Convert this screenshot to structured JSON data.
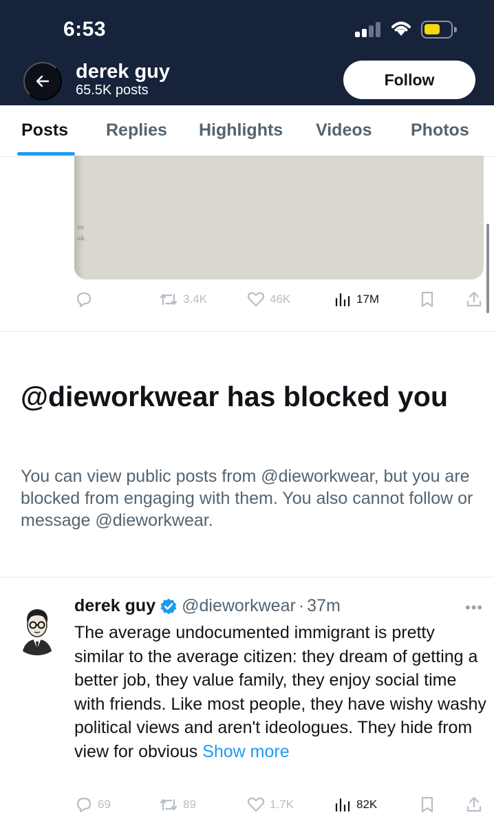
{
  "status_bar": {
    "time": "6:53"
  },
  "header": {
    "name": "derek guy",
    "posts_count": "65.5K posts",
    "follow_label": "Follow"
  },
  "tabs": [
    {
      "label": "Posts",
      "active": true
    },
    {
      "label": "Replies"
    },
    {
      "label": "Highlights"
    },
    {
      "label": "Videos"
    },
    {
      "label": "Photos"
    }
  ],
  "post1": {
    "reposts": "3.4K",
    "likes": "46K",
    "views": "17M"
  },
  "blocked": {
    "title": "@dieworkwear has blocked you",
    "body": "You can view public posts from @dieworkwear, but you are blocked from engaging with them. You also cannot follow or message @dieworkwear."
  },
  "tweet": {
    "name": "derek guy",
    "handle": "@dieworkwear",
    "separator": "·",
    "time": "37m",
    "text": "The average undocumented immigrant is pretty similar to the average citizen: they dream of getting a better job,  they value family, they enjoy social time with friends. Like most people, they have wishy washy political views and aren't ideologues. They hide from view for obvious",
    "show_more": "Show more",
    "replies": "69",
    "reposts": "89",
    "likes": "1.7K",
    "views": "82K"
  },
  "colors": {
    "header_bg": "#16233a",
    "accent": "#1d9bf0",
    "battery": "#f5d90a"
  }
}
